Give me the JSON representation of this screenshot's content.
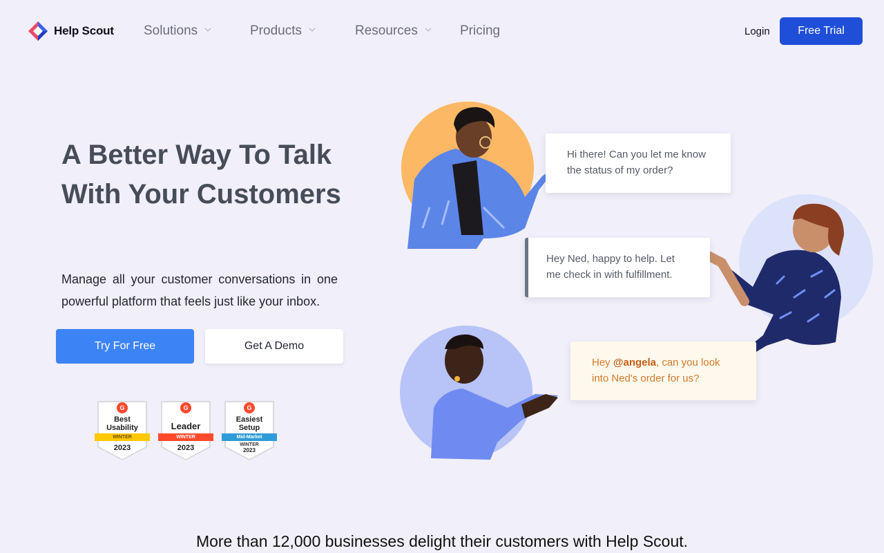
{
  "brand": {
    "name": "Help Scout"
  },
  "nav": {
    "items": [
      {
        "label": "Solutions",
        "dropdown": true
      },
      {
        "label": "Products",
        "dropdown": true
      },
      {
        "label": "Resources",
        "dropdown": true
      },
      {
        "label": "Pricing",
        "dropdown": false
      }
    ],
    "login_label": "Login",
    "cta_label": "Free Trial"
  },
  "hero": {
    "title": "A Better Way To Talk With Your Customers",
    "subtitle": "Manage all your customer conversations in one powerful platform that feels just like your inbox.",
    "primary_button": "Try For Free",
    "secondary_button": "Get A Demo"
  },
  "badges": [
    {
      "title": "Best Usability",
      "ribbon": "WINTER",
      "ribbon_color": "#ffc800",
      "year": "2023"
    },
    {
      "title": "Leader",
      "ribbon": "WINTER",
      "ribbon_color": "#ff492c",
      "year": "2023"
    },
    {
      "title": "Easiest Setup",
      "ribbon": "Mid-Market",
      "ribbon_color": "#2f9bd8",
      "season": "WINTER",
      "year": "2023"
    }
  ],
  "conversation": {
    "message_1": "Hi there! Can you let me know the status of my order?",
    "message_2": "Hey Ned, happy to help. Let me check in with fulfillment.",
    "message_3_prefix": "Hey ",
    "message_3_mention": "@angela",
    "message_3_suffix": ", can you look into Ned's order for us?"
  },
  "footer": {
    "tagline": "More than 12,000 businesses delight their customers with Help Scout."
  },
  "colors": {
    "background": "#f1eff9",
    "primary": "#1f4fd8",
    "button_blue": "#3c83f6",
    "orange_circle": "#fdb865",
    "blue_circle": "#b8c3f7"
  }
}
